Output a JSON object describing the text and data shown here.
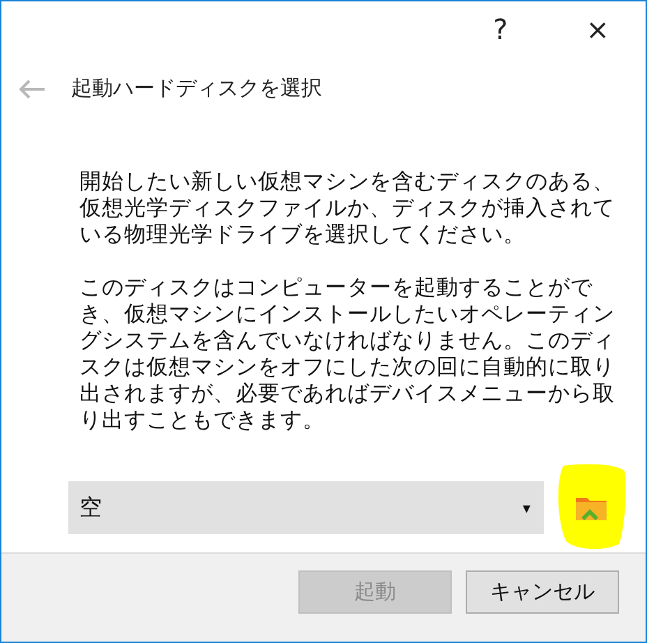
{
  "title_bar": {
    "help": "?",
    "close": "×"
  },
  "header": {
    "title": "起動ハードディスクを選択"
  },
  "paragraphs": [
    "開始したい新しい仮想マシンを含むディスクのある、仮想光学ディスクファイルか、ディスクが挿入されている物理光学ドライブを選択してください。",
    "このディスクはコンピューターを起動することができ、仮想マシンにインストールしたいオペレーティングシステムを含んでいなければなりません。このディスクは仮想マシンをオフにした次の回に自動的に取り出されますが、必要であればデバイスメニューから取り出すこともできます。"
  ],
  "disk_select": {
    "value": "空",
    "caret": "▾"
  },
  "buttons": [
    {
      "label": "起動",
      "disabled": true
    },
    {
      "label": "キャンセル",
      "disabled": false
    }
  ]
}
